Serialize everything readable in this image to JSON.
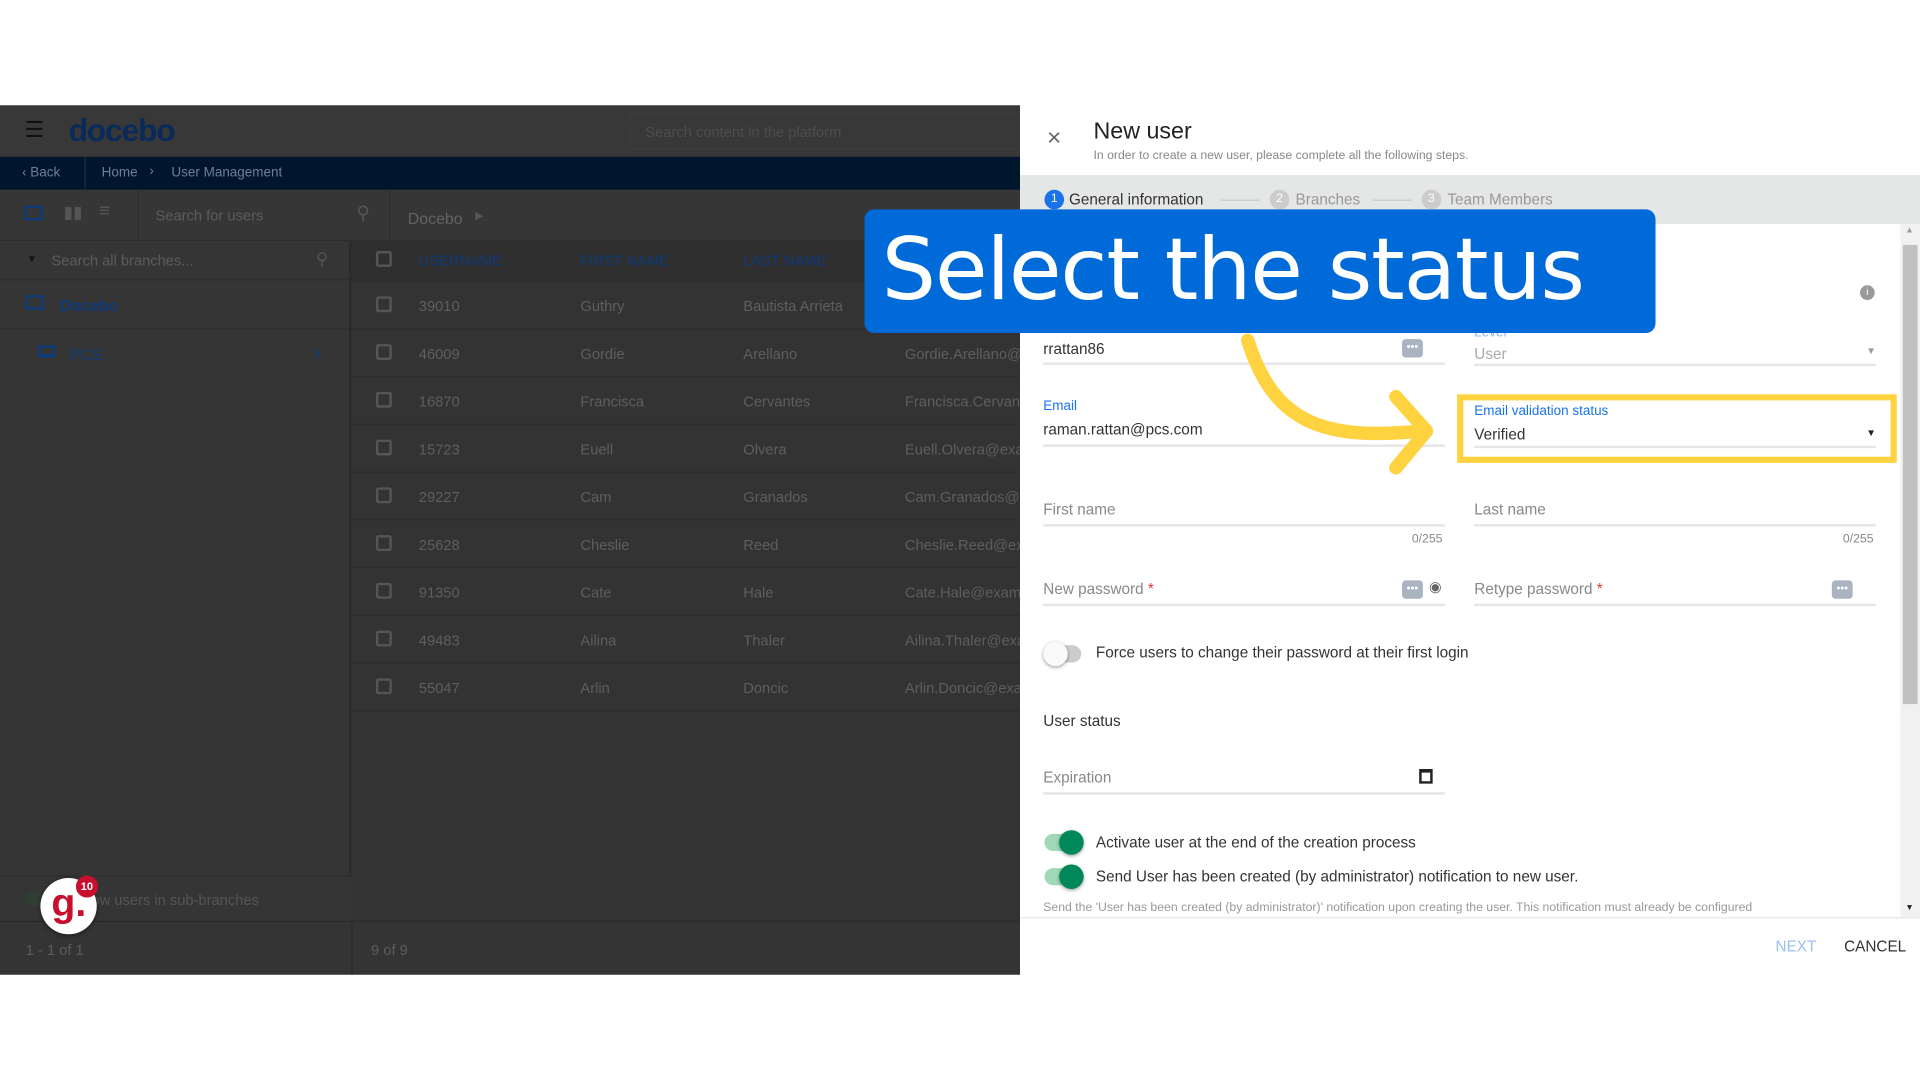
{
  "app": {
    "logo": "docebo",
    "search_placeholder": "Search content in the platform"
  },
  "breadcrumb": {
    "back": "Back",
    "home": "Home",
    "current": "User Management"
  },
  "toolbar": {
    "search_users_placeholder": "Search for users",
    "branch": "Docebo"
  },
  "tree": {
    "search_placeholder": "Search all branches...",
    "items": [
      {
        "label": "Docebo",
        "icon": "folder-open-icon"
      },
      {
        "label": "PCS",
        "icon": "laptop-icon"
      }
    ],
    "sub_branches": "Show users in sub-branches",
    "pagination": "1 - 1 of 1"
  },
  "table": {
    "headers": [
      "USERNAME",
      "FIRST NAME",
      "LAST NAME"
    ],
    "rows": [
      [
        "39010",
        "Guthry",
        "Bautista Arrieta",
        ""
      ],
      [
        "46009",
        "Gordie",
        "Arellano",
        "Gordie.Arellano@"
      ],
      [
        "16870",
        "Francisca",
        "Cervantes",
        "Francisca.Cervant"
      ],
      [
        "15723",
        "Euell",
        "Olvera",
        "Euell.Olvera@exa"
      ],
      [
        "29227",
        "Cam",
        "Granados",
        "Cam.Granados@e"
      ],
      [
        "25628",
        "Cheslie",
        "Reed",
        "Cheslie.Reed@ex"
      ],
      [
        "91350",
        "Cate",
        "Hale",
        "Cate.Hale@exam"
      ],
      [
        "49483",
        "Ailina",
        "Thaler",
        "Ailina.Thaler@exa"
      ],
      [
        "55047",
        "Arlin",
        "Doncic",
        "Arlin.Doncic@exa"
      ]
    ],
    "pagination": "9 of 9"
  },
  "badge": {
    "count": "10",
    "logo": "g."
  },
  "dialog": {
    "title": "New user",
    "subtitle": "In order to create a new user, please complete all the following steps.",
    "steps": [
      {
        "num": "1",
        "label": "General information"
      },
      {
        "num": "2",
        "label": "Branches"
      },
      {
        "num": "3",
        "label": "Team Members"
      }
    ],
    "username": "rrattan86",
    "level_label": "Level",
    "level_value": "User",
    "email_label": "Email",
    "email_value": "raman.rattan@pcs.com",
    "email_status_label": "Email validation status",
    "email_status_value": "Verified",
    "first_name": "First name",
    "last_name": "Last name",
    "counter": "0/255",
    "new_password": "New password",
    "retype_password": "Retype password",
    "required_mark": "*",
    "force_change": "Force users to change their password at their first login",
    "force_change_on": false,
    "user_status": "User status",
    "expiration": "Expiration",
    "activate": "Activate user at the end of the creation process",
    "activate_on": true,
    "send_notification": "Send User has been created (by administrator) notification to new user.",
    "send_notification_on": true,
    "notification_help": "Send the 'User has been created (by administrator)' notification upon creating the user. This notification must already be configured",
    "next": "NEXT",
    "cancel": "CANCEL"
  },
  "callout": {
    "text": "Select the status"
  },
  "colors": {
    "accent": "#1a73e8",
    "callout": "#006ad8",
    "highlight": "#ffd23f",
    "toggle_on": "#00875a"
  }
}
